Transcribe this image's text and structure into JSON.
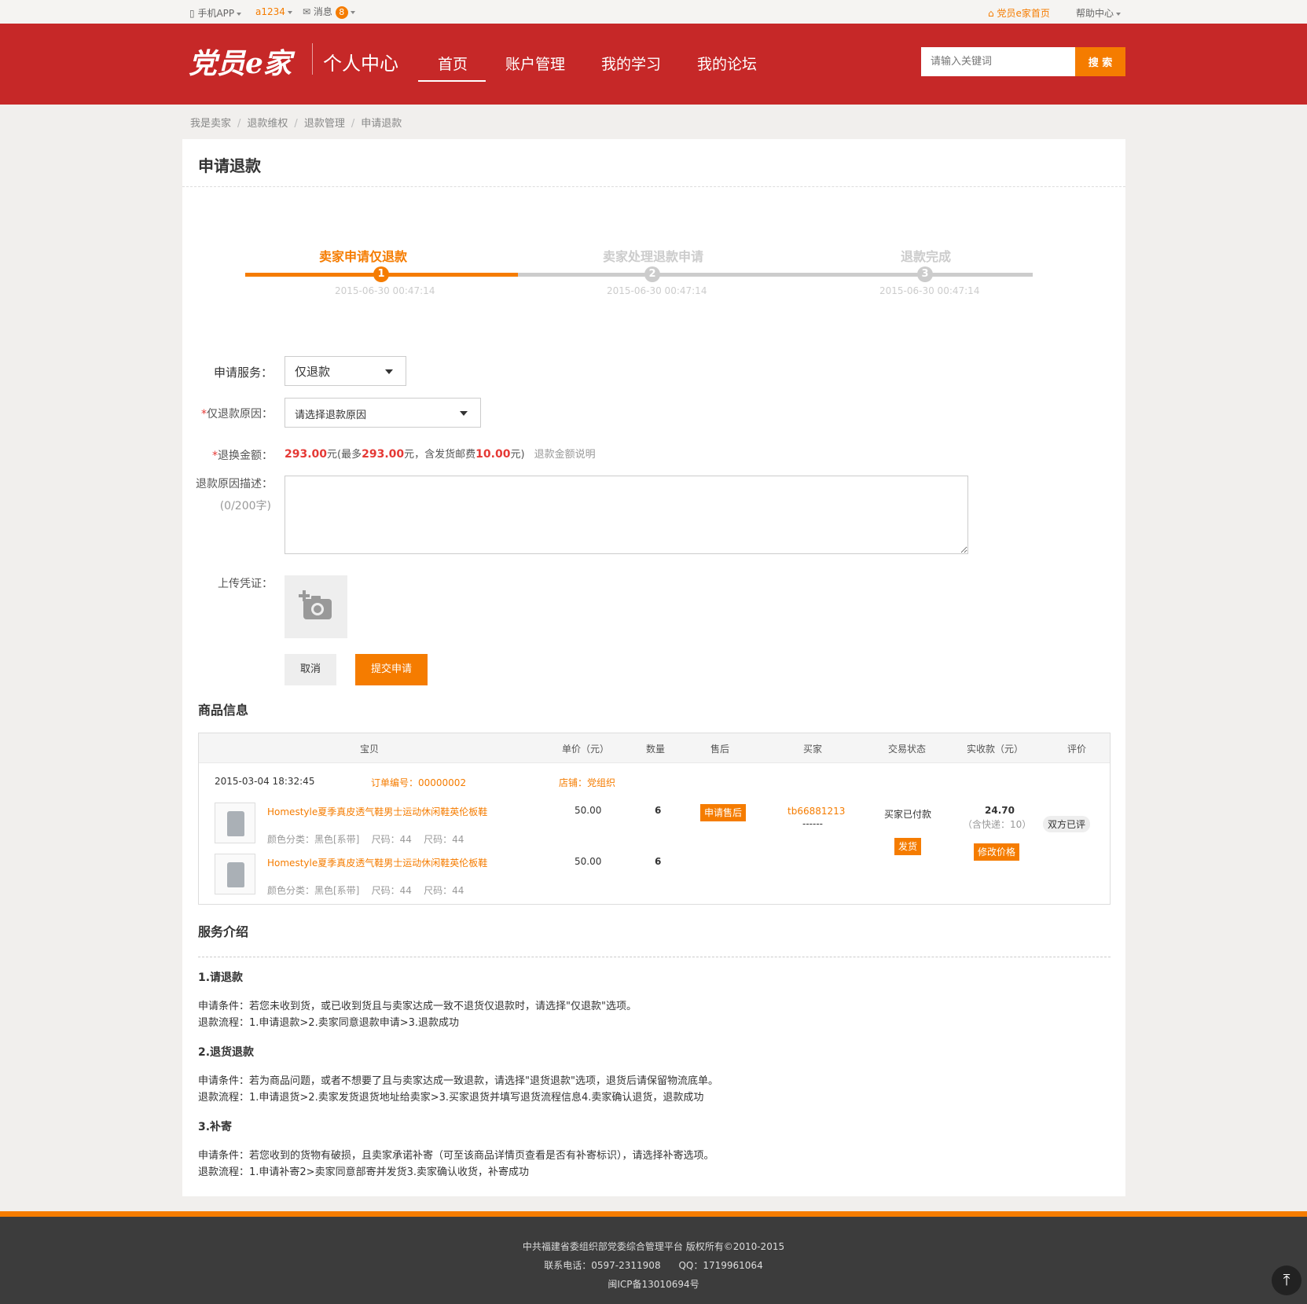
{
  "topbar": {
    "app": "手机APP",
    "user": "a1234",
    "msg": "消息",
    "msg_count": "8",
    "home": "党员e家首页",
    "help": "帮助中心"
  },
  "header": {
    "logo": "党员e家",
    "subtitle": "个人中心",
    "nav": [
      "首页",
      "账户管理",
      "我的学习",
      "我的论坛"
    ],
    "search_placeholder": "请输入关键词",
    "search_btn": "搜 索"
  },
  "breadcrumb": [
    "我是卖家",
    "退款维权",
    "退款管理",
    "申请退款"
  ],
  "page_title": "申请退款",
  "steps": [
    {
      "num": "1",
      "label": "卖家申请仅退款",
      "date": "2015-06-30 00:47:14"
    },
    {
      "num": "2",
      "label": "卖家处理退款申请",
      "date": "2015-06-30 00:47:14"
    },
    {
      "num": "3",
      "label": "退款完成",
      "date": "2015-06-30 00:47:14"
    }
  ],
  "form": {
    "service_label": "申请服务：",
    "service_value": "仅退款",
    "reason_star": "*",
    "reason_label": "仅退款原因：",
    "reason_value": "请选择退款原因",
    "amount_star": "*",
    "amount_label": "退换金额：",
    "amount": "293.00",
    "amount_mid": "元(最多",
    "amount_max": "293.00",
    "amount_mid2": "元，含发货邮费",
    "amount_fee": "10.00",
    "amount_end": "元)",
    "amount_link": "退款金额说明",
    "desc_label": "退款原因描述：",
    "desc_count": "(0/200字)",
    "upload_label": "上传凭证：",
    "cancel": "取消",
    "submit": "提交申请"
  },
  "goods": {
    "title": "商品信息",
    "headers": [
      "宝贝",
      "单价（元）",
      "数量",
      "售后",
      "买家",
      "交易状态",
      "实收款（元）",
      "评价"
    ],
    "order_time": "2015-03-04 18:32:45",
    "order_no": "订单编号：00000002",
    "shop": "店铺：党组织",
    "items": [
      {
        "name": "Homestyle夏季真皮透气鞋男士运动休闲鞋英伦板鞋",
        "attrs": "颜色分类：黑色[系带]    尺码：44    尺码：44",
        "price": "50.00",
        "qty": "6"
      },
      {
        "name": "Homestyle夏季真皮透气鞋男士运动休闲鞋英伦板鞋",
        "attrs": "颜色分类：黑色[系带]    尺码：44    尺码：44",
        "price": "50.00",
        "qty": "6"
      }
    ],
    "aftersale_btn": "申请售后",
    "buyer": "tb66881213",
    "buyer_sub": "------",
    "status": "买家已付款",
    "ship_btn": "发货",
    "total": "24.70",
    "total_sub": "（含快递：10）",
    "modify_btn": "修改价格",
    "review": "双方已评"
  },
  "service": {
    "title": "服务介绍",
    "sections": [
      {
        "h": "1.请退款",
        "l1": "申请条件：若您未收到货，或已收到货且与卖家达成一致不退货仅退款时，请选择\"仅退款\"选项。",
        "l2": "退款流程：1.申请退款>2.卖家同意退款申请>3.退款成功"
      },
      {
        "h": "2.退货退款",
        "l1": "申请条件：若为商品问题，或者不想要了且与卖家达成一致退款，请选择\"退货退款\"选项，退货后请保留物流底单。",
        "l2": "退款流程：1.申请退货>2.卖家发货退货地址给卖家>3.买家退货并填写退货流程信息4.卖家确认退货，退款成功"
      },
      {
        "h": "3.补寄",
        "l1": "申请条件：若您收到的货物有破损，且卖家承诺补寄（可至该商品详情页查看是否有补寄标识），请选择补寄选项。",
        "l2": "退款流程：1.申请补寄2>卖家同意部寄并发货3.卖家确认收货，补寄成功"
      }
    ]
  },
  "footer": {
    "l1": "中共福建省委组织部党委综合管理平台 版权所有©2010-2015",
    "l2": "联系电话：0597-2311908      QQ：1719961064",
    "l3": "闽ICP备13010694号"
  },
  "colors": {
    "red": "#c62828",
    "orange": "#f57c00"
  }
}
